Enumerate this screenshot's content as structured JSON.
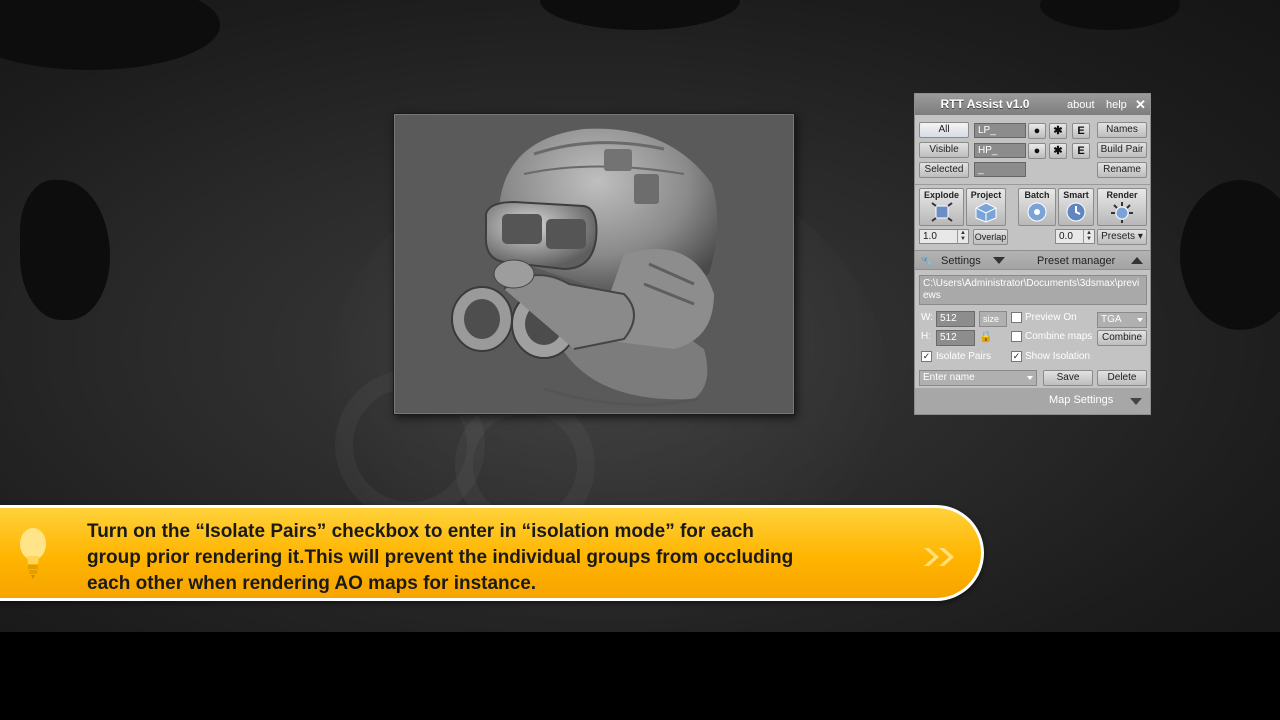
{
  "panel": {
    "title": "RTT Assist v1.0",
    "about": "about",
    "help": "help",
    "filter_buttons": [
      "All",
      "Visible",
      "Selected"
    ],
    "name_fields": [
      "LP_",
      "HP_",
      "_"
    ],
    "right_buttons": [
      "Names",
      "Build Pair",
      "Rename"
    ],
    "icon_buttons": [
      "Explode",
      "Project",
      "Batch",
      "Smart",
      "Render"
    ],
    "explode_value": "1.0",
    "overlap_label": "Overlap",
    "smart_value": "0.0",
    "presets_label": "Presets",
    "settings_label": "Settings",
    "preset_manager_label": "Preset manager",
    "output_path": "C:\\Users\\Administrator\\Documents\\3dsmax\\previews",
    "width_label": "W:",
    "height_label": "H:",
    "width_value": "512",
    "height_value": "512",
    "size_label": "size",
    "preview_on_label": "Preview On",
    "preview_on_checked": false,
    "format_value": "TGA",
    "combine_maps_label": "Combine maps",
    "combine_maps_checked": false,
    "combine_button": "Combine",
    "isolate_pairs_label": "Isolate Pairs",
    "isolate_pairs_checked": true,
    "show_isolation_label": "Show Isolation",
    "show_isolation_checked": true,
    "enter_name_placeholder": "Enter name",
    "save_button": "Save",
    "delete_button": "Delete",
    "map_settings_label": "Map Settings"
  },
  "caption": {
    "line1": "Turn on the “Isolate Pairs” checkbox to enter in “isolation mode” for each",
    "line2": "group prior rendering it.This will prevent the individual groups from occluding",
    "line3": "each other when rendering AO maps for instance."
  },
  "colors": {
    "banner_accent": "#ffb400",
    "panel_bg": "#c3c3c3",
    "viewport_bg": "#5a5a5a"
  }
}
